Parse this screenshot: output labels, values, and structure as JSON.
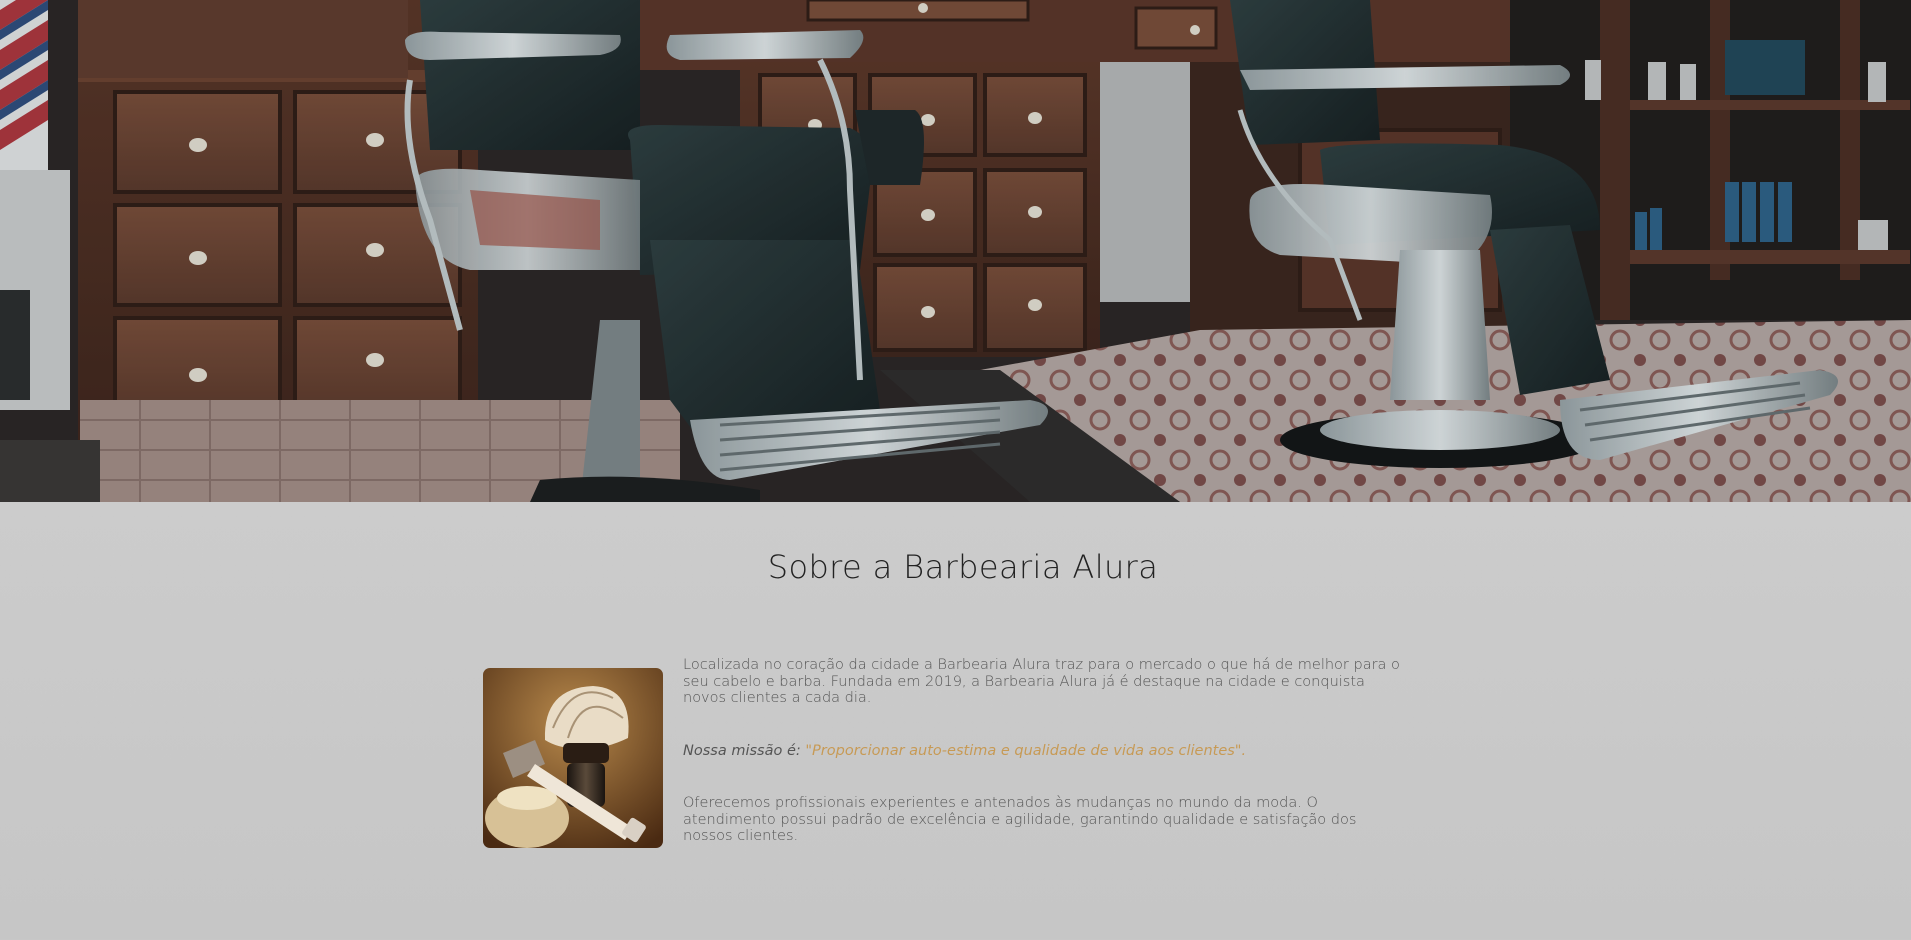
{
  "hero": {
    "image": "barbershop-chairs-photo"
  },
  "about": {
    "title": "Sobre a Barbearia Alura",
    "photo": "shaving-brush-razor-photo",
    "paragraph1": "Localizada no coração da cidade a Barbearia Alura traz para o mercado o que há de melhor para o seu cabelo e barba. Fundada em 2019, a Barbearia Alura já é destaque na cidade e conquista novos clientes a cada dia.",
    "mission_label": "Nossa missão é: ",
    "mission_quote": "\"Proporcionar auto-estima e qualidade de vida aos clientes\".",
    "paragraph3": "Oferecemos profissionais experientes e antenados às mudanças no mundo da moda. O atendimento possui padrão de excelência e agilidade, garantindo qualidade e satisfação dos nossos clientes."
  },
  "colors": {
    "background": "#cdcdcd",
    "title": "#222222",
    "body_text": "#555555",
    "accent": "#c79a55"
  }
}
